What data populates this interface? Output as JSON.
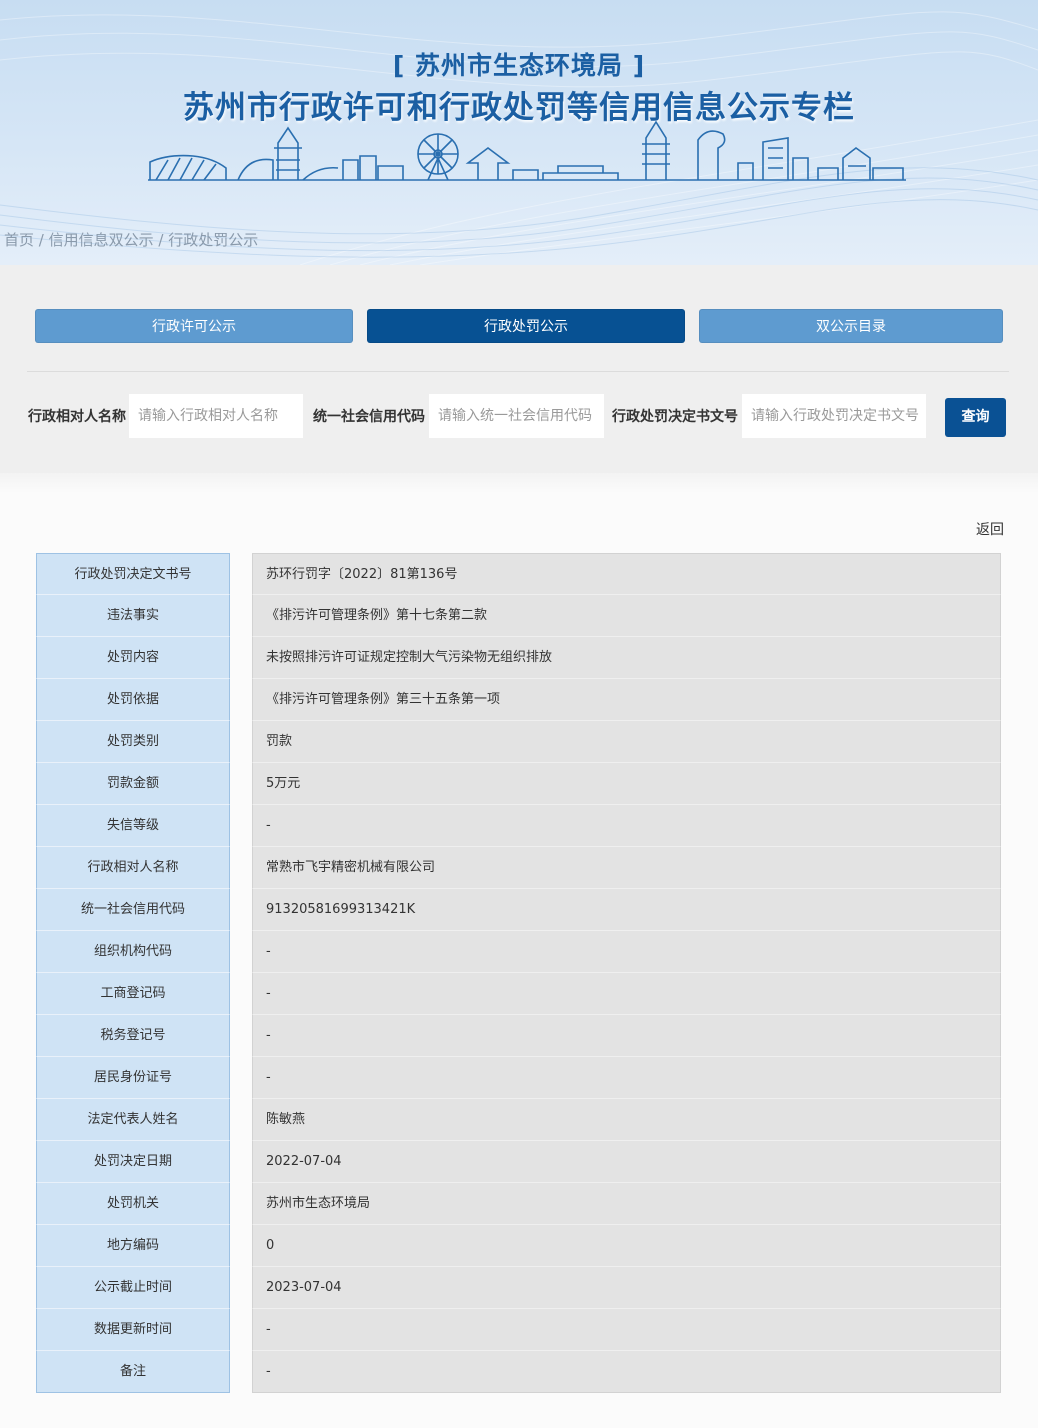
{
  "header": {
    "subtitle": "[ 苏州市生态环境局 ]",
    "title": "苏州市行政许可和行政处罚等信用信息公示专栏"
  },
  "breadcrumb": {
    "items": [
      "首页",
      "信用信息双公示",
      "行政处罚公示"
    ],
    "separator": " / "
  },
  "tabs": [
    {
      "label": "行政许可公示",
      "active": false
    },
    {
      "label": "行政处罚公示",
      "active": true
    },
    {
      "label": "双公示目录",
      "active": false
    }
  ],
  "filters": [
    {
      "label": "行政相对人名称",
      "placeholder": "请输入行政相对人名称"
    },
    {
      "label": "统一社会信用代码",
      "placeholder": "请输入统一社会信用代码"
    },
    {
      "label": "行政处罚决定书文号",
      "placeholder": "请输入行政处罚决定书文号"
    }
  ],
  "search_button": "查询",
  "back_link": "返回",
  "detail_rows": [
    {
      "label": "行政处罚决定文书号",
      "value": "苏环行罚字〔2022〕81第136号"
    },
    {
      "label": "违法事实",
      "value": "《排污许可管理条例》第十七条第二款"
    },
    {
      "label": "处罚内容",
      "value": "未按照排污许可证规定控制大气污染物无组织排放"
    },
    {
      "label": "处罚依据",
      "value": "《排污许可管理条例》第三十五条第一项"
    },
    {
      "label": "处罚类别",
      "value": "罚款"
    },
    {
      "label": "罚款金额",
      "value": "5万元"
    },
    {
      "label": "失信等级",
      "value": "-"
    },
    {
      "label": "行政相对人名称",
      "value": "常熟市飞宇精密机械有限公司"
    },
    {
      "label": "统一社会信用代码",
      "value": "91320581699313421K"
    },
    {
      "label": "组织机构代码",
      "value": "-"
    },
    {
      "label": "工商登记码",
      "value": "-"
    },
    {
      "label": "税务登记号",
      "value": "-"
    },
    {
      "label": "居民身份证号",
      "value": "-"
    },
    {
      "label": "法定代表人姓名",
      "value": "陈敏燕"
    },
    {
      "label": "处罚决定日期",
      "value": "2022-07-04"
    },
    {
      "label": "处罚机关",
      "value": "苏州市生态环境局"
    },
    {
      "label": "地方编码",
      "value": "0"
    },
    {
      "label": "公示截止时间",
      "value": "2023-07-04"
    },
    {
      "label": "数据更新时间",
      "value": "-"
    },
    {
      "label": "备注",
      "value": "-"
    }
  ],
  "colors": {
    "brand_blue": "#075193",
    "tab_light_blue": "#5e9bd0",
    "label_cell_bg": "#cfe3f5",
    "value_cell_bg": "#e3e3e3"
  }
}
